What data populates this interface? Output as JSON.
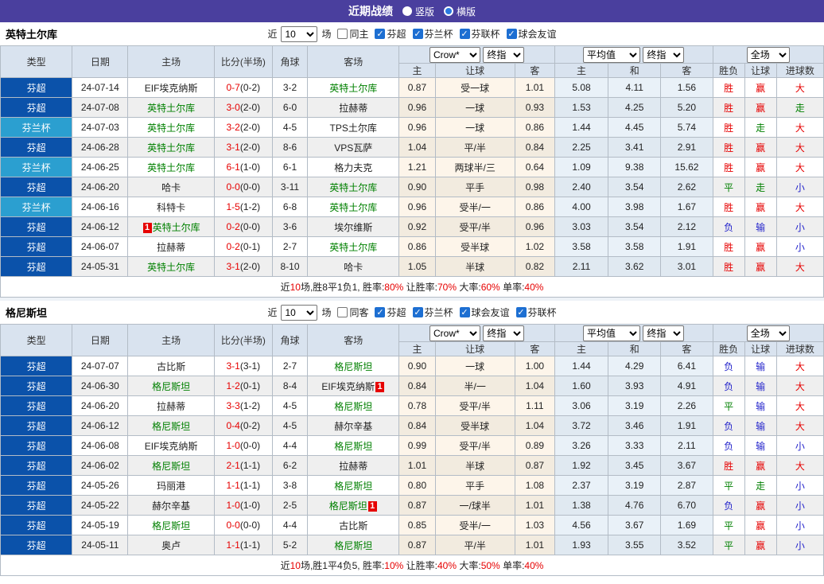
{
  "topbar": {
    "title": "近期战绩",
    "options": [
      {
        "label": "竖版",
        "selected": false
      },
      {
        "label": "横版",
        "selected": true
      }
    ]
  },
  "colors": {
    "header_purple": "#4a3f9e",
    "league_badge_blue": "#0b52aa",
    "cup_badge_blue": "#2b9fd0",
    "team_green": "#008000",
    "result_red": "#e60000",
    "result_blue": "#2323cb",
    "result_green": "#008000",
    "header_bg": "#d9e3ef",
    "odds_col_bg": "#fdf5ea",
    "avg_col_bg": "#e9f1f8",
    "red_card_badge": "#e60000"
  },
  "icons": {
    "checkbox_checked": "✓",
    "radio_selected": "blue-dot"
  },
  "tables": [
    {
      "team": "英特土尔库",
      "filter": {
        "near": "近",
        "count": "10",
        "games": "场",
        "same": {
          "label": "同主",
          "checked": false
        },
        "leagues": [
          {
            "label": "芬超",
            "checked": true
          },
          {
            "label": "芬兰杯",
            "checked": true
          },
          {
            "label": "芬联杯",
            "checked": true
          },
          {
            "label": "球会友谊",
            "checked": true
          }
        ]
      },
      "header": {
        "type": "类型",
        "date": "日期",
        "home": "主场",
        "score": "比分(半场)",
        "corner": "角球",
        "away": "客场",
        "odds_source": "Crow*",
        "odds_stage": "终指",
        "avg_source": "平均值",
        "avg_stage": "终指",
        "result_scope": "全场",
        "sub": [
          "主",
          "让球",
          "客",
          "主",
          "和",
          "客",
          "胜负",
          "让球",
          "进球数"
        ]
      },
      "rows": [
        {
          "type": "芬超",
          "kind": "league",
          "date": "24-07-14",
          "home": "EIF埃克纳斯",
          "home_green": false,
          "home_badge_pre": "",
          "away": "英特土尔库",
          "away_green": true,
          "away_badge_post": "",
          "score_ft": "0-7",
          "score_ht": "(0-2)",
          "corner": "3-2",
          "h_odds": "0.87",
          "handicap": "受一球",
          "a_odds": "1.01",
          "avg_h": "5.08",
          "avg_d": "4.11",
          "avg_a": "1.56",
          "res_w": "胜",
          "res_w_c": "red",
          "res_h": "赢",
          "res_h_c": "red",
          "res_g": "大",
          "res_g_c": "red"
        },
        {
          "type": "芬超",
          "kind": "league",
          "date": "24-07-08",
          "home": "英特土尔库",
          "home_green": true,
          "home_badge_pre": "",
          "away": "拉赫蒂",
          "away_green": false,
          "away_badge_post": "",
          "score_ft": "3-0",
          "score_ht": "(2-0)",
          "corner": "6-0",
          "h_odds": "0.96",
          "handicap": "一球",
          "a_odds": "0.93",
          "avg_h": "1.53",
          "avg_d": "4.25",
          "avg_a": "5.20",
          "res_w": "胜",
          "res_w_c": "red",
          "res_h": "赢",
          "res_h_c": "red",
          "res_g": "走",
          "res_g_c": "green"
        },
        {
          "type": "芬兰杯",
          "kind": "cup",
          "date": "24-07-03",
          "home": "英特土尔库",
          "home_green": true,
          "home_badge_pre": "",
          "away": "TPS土尔库",
          "away_green": false,
          "away_badge_post": "",
          "score_ft": "3-2",
          "score_ht": "(2-0)",
          "corner": "4-5",
          "h_odds": "0.96",
          "handicap": "一球",
          "a_odds": "0.86",
          "avg_h": "1.44",
          "avg_d": "4.45",
          "avg_a": "5.74",
          "res_w": "胜",
          "res_w_c": "red",
          "res_h": "走",
          "res_h_c": "green",
          "res_g": "大",
          "res_g_c": "red"
        },
        {
          "type": "芬超",
          "kind": "league",
          "date": "24-06-28",
          "home": "英特土尔库",
          "home_green": true,
          "home_badge_pre": "",
          "away": "VPS瓦萨",
          "away_green": false,
          "away_badge_post": "",
          "score_ft": "3-1",
          "score_ht": "(2-0)",
          "corner": "8-6",
          "h_odds": "1.04",
          "handicap": "平/半",
          "a_odds": "0.84",
          "avg_h": "2.25",
          "avg_d": "3.41",
          "avg_a": "2.91",
          "res_w": "胜",
          "res_w_c": "red",
          "res_h": "赢",
          "res_h_c": "red",
          "res_g": "大",
          "res_g_c": "red"
        },
        {
          "type": "芬兰杯",
          "kind": "cup",
          "date": "24-06-25",
          "home": "英特土尔库",
          "home_green": true,
          "home_badge_pre": "",
          "away": "格力夫克",
          "away_green": false,
          "away_badge_post": "",
          "score_ft": "6-1",
          "score_ht": "(1-0)",
          "corner": "6-1",
          "h_odds": "1.21",
          "handicap": "两球半/三",
          "a_odds": "0.64",
          "avg_h": "1.09",
          "avg_d": "9.38",
          "avg_a": "15.62",
          "res_w": "胜",
          "res_w_c": "red",
          "res_h": "赢",
          "res_h_c": "red",
          "res_g": "大",
          "res_g_c": "red"
        },
        {
          "type": "芬超",
          "kind": "league",
          "date": "24-06-20",
          "home": "哈卡",
          "home_green": false,
          "home_badge_pre": "",
          "away": "英特土尔库",
          "away_green": true,
          "away_badge_post": "",
          "score_ft": "0-0",
          "score_ht": "(0-0)",
          "corner": "3-11",
          "h_odds": "0.90",
          "handicap": "平手",
          "a_odds": "0.98",
          "avg_h": "2.40",
          "avg_d": "3.54",
          "avg_a": "2.62",
          "res_w": "平",
          "res_w_c": "green",
          "res_h": "走",
          "res_h_c": "green",
          "res_g": "小",
          "res_g_c": "blue"
        },
        {
          "type": "芬兰杯",
          "kind": "cup",
          "date": "24-06-16",
          "home": "科特卡",
          "home_green": false,
          "home_badge_pre": "",
          "away": "英特土尔库",
          "away_green": true,
          "away_badge_post": "",
          "score_ft": "1-5",
          "score_ht": "(1-2)",
          "corner": "6-8",
          "h_odds": "0.96",
          "handicap": "受半/一",
          "a_odds": "0.86",
          "avg_h": "4.00",
          "avg_d": "3.98",
          "avg_a": "1.67",
          "res_w": "胜",
          "res_w_c": "red",
          "res_h": "赢",
          "res_h_c": "red",
          "res_g": "大",
          "res_g_c": "red"
        },
        {
          "type": "芬超",
          "kind": "league",
          "date": "24-06-12",
          "home": "英特土尔库",
          "home_green": true,
          "home_badge_pre": "1",
          "away": "埃尔维斯",
          "away_green": false,
          "away_badge_post": "",
          "score_ft": "0-2",
          "score_ht": "(0-0)",
          "corner": "3-6",
          "h_odds": "0.92",
          "handicap": "受平/半",
          "a_odds": "0.96",
          "avg_h": "3.03",
          "avg_d": "3.54",
          "avg_a": "2.12",
          "res_w": "负",
          "res_w_c": "blue",
          "res_h": "输",
          "res_h_c": "blue",
          "res_g": "小",
          "res_g_c": "blue"
        },
        {
          "type": "芬超",
          "kind": "league",
          "date": "24-06-07",
          "home": "拉赫蒂",
          "home_green": false,
          "home_badge_pre": "",
          "away": "英特土尔库",
          "away_green": true,
          "away_badge_post": "",
          "score_ft": "0-2",
          "score_ht": "(0-1)",
          "corner": "2-7",
          "h_odds": "0.86",
          "handicap": "受半球",
          "a_odds": "1.02",
          "avg_h": "3.58",
          "avg_d": "3.58",
          "avg_a": "1.91",
          "res_w": "胜",
          "res_w_c": "red",
          "res_h": "赢",
          "res_h_c": "red",
          "res_g": "小",
          "res_g_c": "blue"
        },
        {
          "type": "芬超",
          "kind": "league",
          "date": "24-05-31",
          "home": "英特土尔库",
          "home_green": true,
          "home_badge_pre": "",
          "away": "哈卡",
          "away_green": false,
          "away_badge_post": "",
          "score_ft": "3-1",
          "score_ht": "(2-0)",
          "corner": "8-10",
          "h_odds": "1.05",
          "handicap": "半球",
          "a_odds": "0.82",
          "avg_h": "2.11",
          "avg_d": "3.62",
          "avg_a": "3.01",
          "res_w": "胜",
          "res_w_c": "red",
          "res_h": "赢",
          "res_h_c": "red",
          "res_g": "大",
          "res_g_c": "red"
        }
      ],
      "summary": [
        {
          "t": "近"
        },
        {
          "t": "10",
          "red": true
        },
        {
          "t": "场,胜8平1负1, 胜率:"
        },
        {
          "t": "80%",
          "red": true
        },
        {
          "t": " 让胜率:"
        },
        {
          "t": "70%",
          "red": true
        },
        {
          "t": " 大率:"
        },
        {
          "t": "60%",
          "red": true
        },
        {
          "t": " 单率:"
        },
        {
          "t": "40%",
          "red": true
        }
      ]
    },
    {
      "team": "格尼斯坦",
      "filter": {
        "near": "近",
        "count": "10",
        "games": "场",
        "same": {
          "label": "同客",
          "checked": false
        },
        "leagues": [
          {
            "label": "芬超",
            "checked": true
          },
          {
            "label": "芬兰杯",
            "checked": true
          },
          {
            "label": "球会友谊",
            "checked": true
          },
          {
            "label": "芬联杯",
            "checked": true
          }
        ]
      },
      "header": {
        "type": "类型",
        "date": "日期",
        "home": "主场",
        "score": "比分(半场)",
        "corner": "角球",
        "away": "客场",
        "odds_source": "Crow*",
        "odds_stage": "终指",
        "avg_source": "平均值",
        "avg_stage": "终指",
        "result_scope": "全场",
        "sub": [
          "主",
          "让球",
          "客",
          "主",
          "和",
          "客",
          "胜负",
          "让球",
          "进球数"
        ]
      },
      "rows": [
        {
          "type": "芬超",
          "kind": "league",
          "date": "24-07-07",
          "home": "古比斯",
          "home_green": false,
          "home_badge_pre": "",
          "away": "格尼斯坦",
          "away_green": true,
          "away_badge_post": "",
          "score_ft": "3-1",
          "score_ht": "(3-1)",
          "corner": "2-7",
          "h_odds": "0.90",
          "handicap": "一球",
          "a_odds": "1.00",
          "avg_h": "1.44",
          "avg_d": "4.29",
          "avg_a": "6.41",
          "res_w": "负",
          "res_w_c": "blue",
          "res_h": "输",
          "res_h_c": "blue",
          "res_g": "大",
          "res_g_c": "red"
        },
        {
          "type": "芬超",
          "kind": "league",
          "date": "24-06-30",
          "home": "格尼斯坦",
          "home_green": true,
          "home_badge_pre": "",
          "away": "EIF埃克纳斯",
          "away_green": false,
          "away_badge_post": "1",
          "score_ft": "1-2",
          "score_ht": "(0-1)",
          "corner": "8-4",
          "h_odds": "0.84",
          "handicap": "半/一",
          "a_odds": "1.04",
          "avg_h": "1.60",
          "avg_d": "3.93",
          "avg_a": "4.91",
          "res_w": "负",
          "res_w_c": "blue",
          "res_h": "输",
          "res_h_c": "blue",
          "res_g": "大",
          "res_g_c": "red"
        },
        {
          "type": "芬超",
          "kind": "league",
          "date": "24-06-20",
          "home": "拉赫蒂",
          "home_green": false,
          "home_badge_pre": "",
          "away": "格尼斯坦",
          "away_green": true,
          "away_badge_post": "",
          "score_ft": "3-3",
          "score_ht": "(1-2)",
          "corner": "4-5",
          "h_odds": "0.78",
          "handicap": "受平/半",
          "a_odds": "1.11",
          "avg_h": "3.06",
          "avg_d": "3.19",
          "avg_a": "2.26",
          "res_w": "平",
          "res_w_c": "green",
          "res_h": "输",
          "res_h_c": "blue",
          "res_g": "大",
          "res_g_c": "red"
        },
        {
          "type": "芬超",
          "kind": "league",
          "date": "24-06-12",
          "home": "格尼斯坦",
          "home_green": true,
          "home_badge_pre": "",
          "away": "赫尔辛基",
          "away_green": false,
          "away_badge_post": "",
          "score_ft": "0-4",
          "score_ht": "(0-2)",
          "corner": "4-5",
          "h_odds": "0.84",
          "handicap": "受半球",
          "a_odds": "1.04",
          "avg_h": "3.72",
          "avg_d": "3.46",
          "avg_a": "1.91",
          "res_w": "负",
          "res_w_c": "blue",
          "res_h": "输",
          "res_h_c": "blue",
          "res_g": "大",
          "res_g_c": "red"
        },
        {
          "type": "芬超",
          "kind": "league",
          "date": "24-06-08",
          "home": "EIF埃克纳斯",
          "home_green": false,
          "home_badge_pre": "",
          "away": "格尼斯坦",
          "away_green": true,
          "away_badge_post": "",
          "score_ft": "1-0",
          "score_ht": "(0-0)",
          "corner": "4-4",
          "h_odds": "0.99",
          "handicap": "受平/半",
          "a_odds": "0.89",
          "avg_h": "3.26",
          "avg_d": "3.33",
          "avg_a": "2.11",
          "res_w": "负",
          "res_w_c": "blue",
          "res_h": "输",
          "res_h_c": "blue",
          "res_g": "小",
          "res_g_c": "blue"
        },
        {
          "type": "芬超",
          "kind": "league",
          "date": "24-06-02",
          "home": "格尼斯坦",
          "home_green": true,
          "home_badge_pre": "",
          "away": "拉赫蒂",
          "away_green": false,
          "away_badge_post": "",
          "score_ft": "2-1",
          "score_ht": "(1-1)",
          "corner": "6-2",
          "h_odds": "1.01",
          "handicap": "半球",
          "a_odds": "0.87",
          "avg_h": "1.92",
          "avg_d": "3.45",
          "avg_a": "3.67",
          "res_w": "胜",
          "res_w_c": "red",
          "res_h": "赢",
          "res_h_c": "red",
          "res_g": "大",
          "res_g_c": "red"
        },
        {
          "type": "芬超",
          "kind": "league",
          "date": "24-05-26",
          "home": "玛丽港",
          "home_green": false,
          "home_badge_pre": "",
          "away": "格尼斯坦",
          "away_green": true,
          "away_badge_post": "",
          "score_ft": "1-1",
          "score_ht": "(1-1)",
          "corner": "3-8",
          "h_odds": "0.80",
          "handicap": "平手",
          "a_odds": "1.08",
          "avg_h": "2.37",
          "avg_d": "3.19",
          "avg_a": "2.87",
          "res_w": "平",
          "res_w_c": "green",
          "res_h": "走",
          "res_h_c": "green",
          "res_g": "小",
          "res_g_c": "blue"
        },
        {
          "type": "芬超",
          "kind": "league",
          "date": "24-05-22",
          "home": "赫尔辛基",
          "home_green": false,
          "home_badge_pre": "",
          "away": "格尼斯坦",
          "away_green": true,
          "away_badge_post": "1",
          "score_ft": "1-0",
          "score_ht": "(1-0)",
          "corner": "2-5",
          "h_odds": "0.87",
          "handicap": "一/球半",
          "a_odds": "1.01",
          "avg_h": "1.38",
          "avg_d": "4.76",
          "avg_a": "6.70",
          "res_w": "负",
          "res_w_c": "blue",
          "res_h": "赢",
          "res_h_c": "red",
          "res_g": "小",
          "res_g_c": "blue"
        },
        {
          "type": "芬超",
          "kind": "league",
          "date": "24-05-19",
          "home": "格尼斯坦",
          "home_green": true,
          "home_badge_pre": "",
          "away": "古比斯",
          "away_green": false,
          "away_badge_post": "",
          "score_ft": "0-0",
          "score_ht": "(0-0)",
          "corner": "4-4",
          "h_odds": "0.85",
          "handicap": "受半/一",
          "a_odds": "1.03",
          "avg_h": "4.56",
          "avg_d": "3.67",
          "avg_a": "1.69",
          "res_w": "平",
          "res_w_c": "green",
          "res_h": "赢",
          "res_h_c": "red",
          "res_g": "小",
          "res_g_c": "blue"
        },
        {
          "type": "芬超",
          "kind": "league",
          "date": "24-05-11",
          "home": "奥卢",
          "home_green": false,
          "home_badge_pre": "",
          "away": "格尼斯坦",
          "away_green": true,
          "away_badge_post": "",
          "score_ft": "1-1",
          "score_ht": "(1-1)",
          "corner": "5-2",
          "h_odds": "0.87",
          "handicap": "平/半",
          "a_odds": "1.01",
          "avg_h": "1.93",
          "avg_d": "3.55",
          "avg_a": "3.52",
          "res_w": "平",
          "res_w_c": "green",
          "res_h": "赢",
          "res_h_c": "red",
          "res_g": "小",
          "res_g_c": "blue"
        }
      ],
      "summary": [
        {
          "t": "近"
        },
        {
          "t": "10",
          "red": true
        },
        {
          "t": "场,胜1平4负5, 胜率:"
        },
        {
          "t": "10%",
          "red": true
        },
        {
          "t": " 让胜率:"
        },
        {
          "t": "40%",
          "red": true
        },
        {
          "t": " 大率:"
        },
        {
          "t": "50%",
          "red": true
        },
        {
          "t": " 单率:"
        },
        {
          "t": "40%",
          "red": true
        }
      ]
    }
  ]
}
